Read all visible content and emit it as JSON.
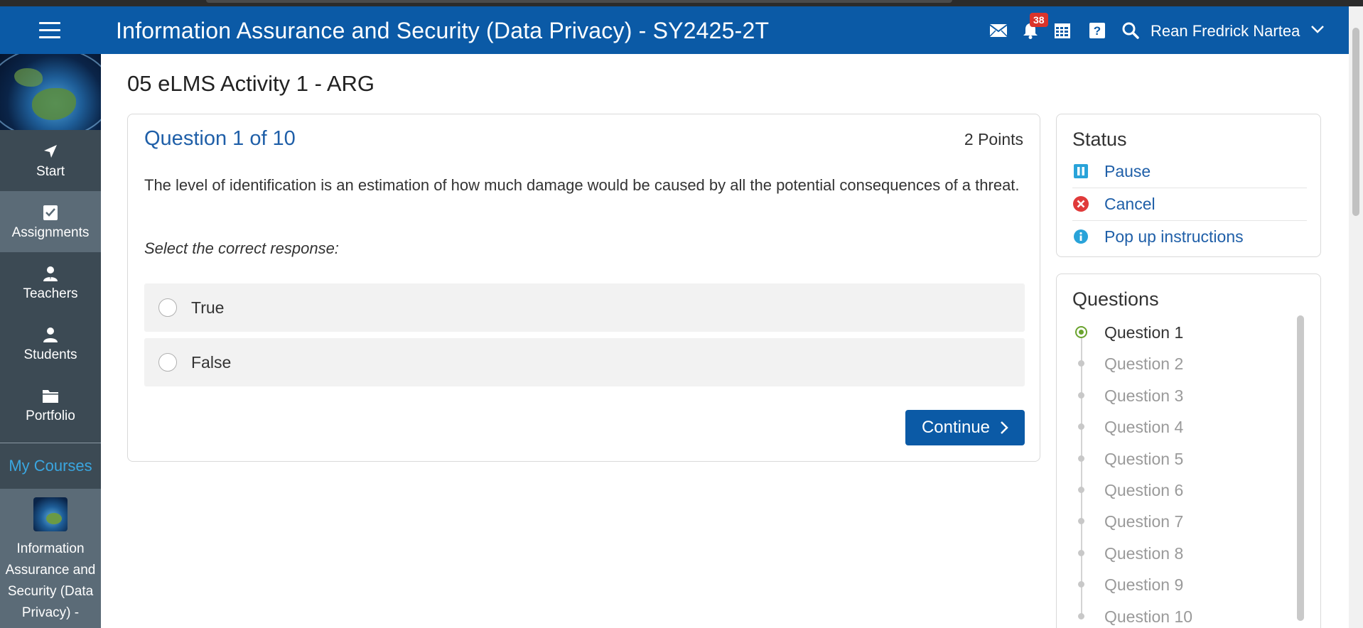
{
  "header": {
    "course_title": "Information Assurance and Security (Data Privacy) - SY2425-2T",
    "notification_count": "38",
    "user_name": "Rean Fredrick Nartea",
    "icons": [
      "menu-icon",
      "mail-icon",
      "bell-icon",
      "calendar-icon",
      "help-icon",
      "search-icon",
      "chevron-down-icon"
    ]
  },
  "sidebar": {
    "items": [
      {
        "label": "Start",
        "icon": "navigation-arrow-icon",
        "active": false
      },
      {
        "label": "Assignments",
        "icon": "checkbox-icon",
        "active": true
      },
      {
        "label": "Teachers",
        "icon": "teacher-icon",
        "active": false
      },
      {
        "label": "Students",
        "icon": "user-icon",
        "active": false
      },
      {
        "label": "Portfolio",
        "icon": "folder-icon",
        "active": false
      }
    ],
    "my_courses_label": "My Courses",
    "course_label": "Information Assurance and Security (Data Privacy) -"
  },
  "page": {
    "title": "05 eLMS Activity 1 - ARG"
  },
  "question": {
    "heading": "Question 1 of 10",
    "points": "2 Points",
    "text": "The level of identification is an estimation of how much damage would be caused by all the potential consequences of a threat.",
    "instruction": "Select the correct response:",
    "options": [
      {
        "label": "True"
      },
      {
        "label": "False"
      }
    ],
    "continue_label": "Continue"
  },
  "status": {
    "heading": "Status",
    "items": [
      {
        "label": "Pause",
        "icon": "pause-icon",
        "color": "#29a3d9"
      },
      {
        "label": "Cancel",
        "icon": "cancel-icon",
        "color": "#e03a3a"
      },
      {
        "label": "Pop up instructions",
        "icon": "info-icon",
        "color": "#29a3d9"
      }
    ]
  },
  "questions_nav": {
    "heading": "Questions",
    "current": 1,
    "items": [
      {
        "label": "Question 1"
      },
      {
        "label": "Question 2"
      },
      {
        "label": "Question 3"
      },
      {
        "label": "Question 4"
      },
      {
        "label": "Question 5"
      },
      {
        "label": "Question 6"
      },
      {
        "label": "Question 7"
      },
      {
        "label": "Question 8"
      },
      {
        "label": "Question 9"
      },
      {
        "label": "Question 10"
      }
    ]
  },
  "colors": {
    "header_bg": "#0b5aa6",
    "sidebar_bg": "#3c4a54",
    "sidebar_active": "#5b6b77",
    "link": "#1f5fa8",
    "current_question": "#6aa32e",
    "badge": "#d9342b"
  }
}
